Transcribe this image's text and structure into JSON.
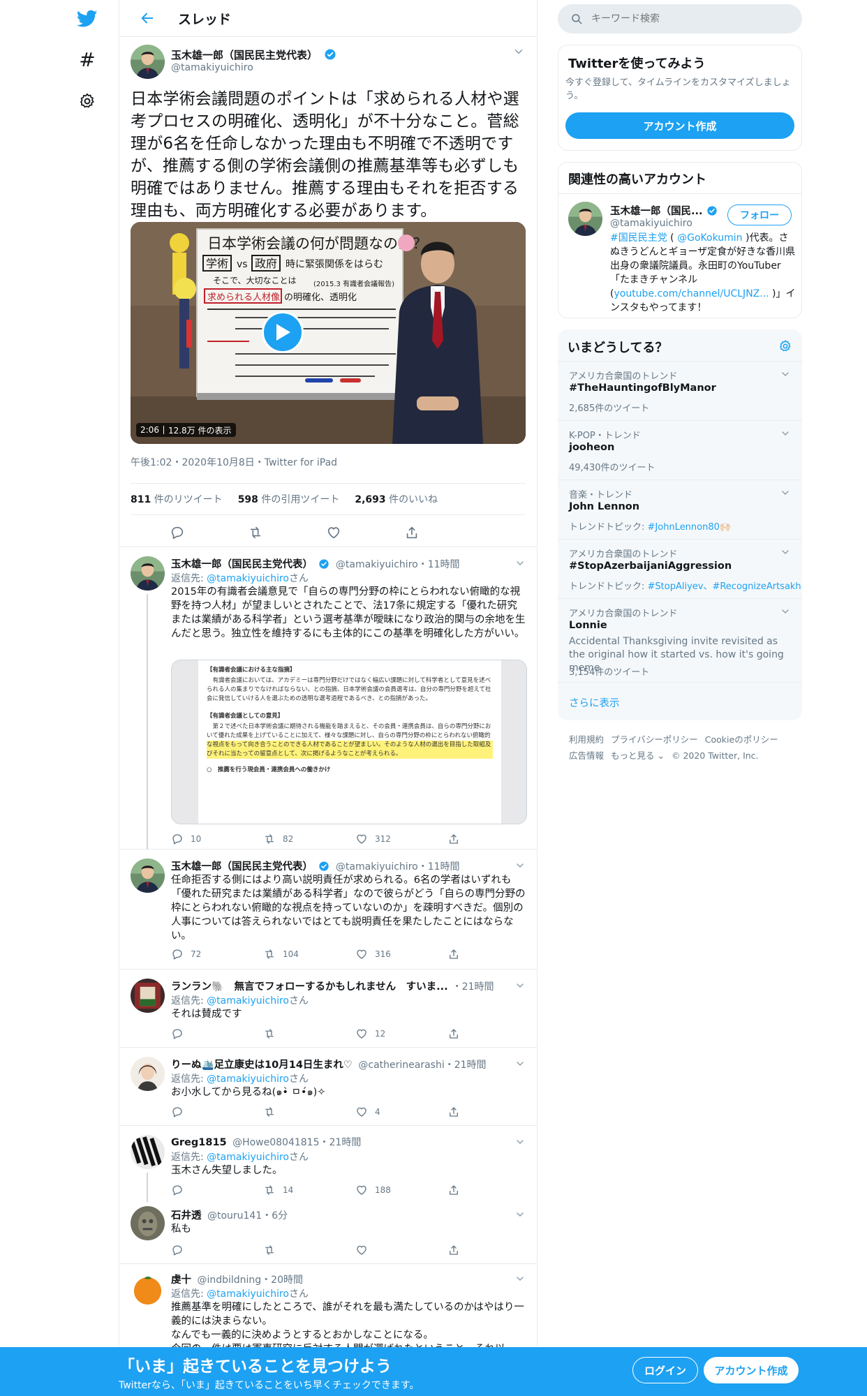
{
  "nav": {
    "logo": "twitter-bird",
    "explore": "#",
    "settings": "gear"
  },
  "header": {
    "title": "スレッド"
  },
  "main_tweet": {
    "name": "玉木雄一郎（国民民主党代表）",
    "handle": "@tamakiyuichiro",
    "text": "日本学術会議問題のポイントは「求められる人材や選考プロセスの明確化、透明化」が不十分なこと。菅総理が6名を任命しなかった理由も不明確で不透明ですが、推薦する側の学術会議側の推薦基準等も必ずしも明確ではありません。推薦する理由もそれを拒否する理由も、両方明確化する必要があります。",
    "video": {
      "duration": "2:06",
      "views": "12.8万 件の表示",
      "board_title": "日本学術会議の何が問題なのか？",
      "board_line1": "学術",
      "board_vs": "vs",
      "board_line1b": "政府",
      "board_line1c": "時に緊張関係をはらむ",
      "board_line2": "そこで、大切なことは",
      "board_line2b": "(2015.3 有識者会議報告)",
      "board_line3": "求められる人材像",
      "board_line3b": "の明確化、透明化"
    },
    "meta": "午後1:02・2020年10月8日・Twitter for iPad",
    "stats": {
      "retweets_num": "811",
      "retweets_label": "件のリツイート",
      "quotes_num": "598",
      "quotes_label": "件の引用ツイート",
      "likes_num": "2,693",
      "likes_label": "件のいいね"
    }
  },
  "replies": [
    {
      "name": "玉木雄一郎（国民民主党代表）",
      "handle": "@tamakiyuichiro",
      "time": "・11時間",
      "replying_label": "返信先:",
      "replying_to": "@tamakiyuichiro",
      "replying_suffix": "さん",
      "text": "2015年の有識者会議意見で「自らの専門分野の枠にとらわれない俯瞰的な視野を持つ人材」が望ましいとされたことで、法17条に規定する「優れた研究または業績がある科学者」という選考基準が曖昧になり政治的関与の余地を生んだと思う。独立性を維持するにも主体的にこの基準を明確化した方がいい。",
      "doc": {
        "h1": "【有識者会議における主な指摘】",
        "p1": "有識者会議においては、アカデミーは専門分野だけではなく幅広い課題に対して科学者として意見を述べられる人の集まりでなければならない、との指摘、日本学術会議の会員選考は、自分の専門分野を超えて社会に発信していける人を選ぶための透明な選考過程であるべき、との指摘があった。",
        "h2": "【有識者会議としての意見】",
        "p2": "第２で述べた日本学術会議に期待される機能を踏まえると、その会員・連携会員は、自らの専門分野において優れた成果を上げていることに加えて、様々な課題に対し、自らの専門分野の枠にとらわれない俯瞰的な視点をもって向き合うことのできる人材であることが望ましい。そのような人材の選出を目指した取組及びそれに当たっての留意点として、次に掲げるようなことが考えられる。",
        "bullet": "○　推薦を行う現会員・連携会員への働きかけ"
      },
      "replies": "10",
      "retweets": "82",
      "likes": "312"
    },
    {
      "name": "玉木雄一郎（国民民主党代表）",
      "handle": "@tamakiyuichiro",
      "time": "・11時間",
      "text": "任命拒否する側にはより高い説明責任が求められる。6名の学者はいずれも「優れた研究または業績がある科学者」なので彼らがどう「自らの専門分野の枠にとらわれない俯瞰的な視点を持っていないのか」を疎明すべきだ。個別の人事については答えられないではとても説明責任を果たしたことにはならない。",
      "replies": "72",
      "retweets": "104",
      "likes": "316"
    },
    {
      "name": "ランラン🐘　無言でフォローするかもしれません　すいま...",
      "time": "・21時間",
      "replying_label": "返信先:",
      "replying_to": "@tamakiyuichiro",
      "replying_suffix": "さん",
      "text": "それは賛成です",
      "likes": "12"
    },
    {
      "name": "りーぬ🛳️足立康史は10月14日生まれ♡",
      "handle": "@catherinearashi",
      "time": "・21時間",
      "replying_label": "返信先:",
      "replying_to": "@tamakiyuichiro",
      "replying_suffix": "さん",
      "text": "お小水してから見るね(๑•̀ ㅁ•́๑)✧",
      "likes": "4"
    },
    {
      "name": "Greg1815",
      "handle": "@Howe08041815",
      "time": "・21時間",
      "replying_label": "返信先:",
      "replying_to": "@tamakiyuichiro",
      "replying_suffix": "さん",
      "text": "玉木さん失望しました。",
      "retweets": "14",
      "likes": "188"
    },
    {
      "name": "石井透",
      "handle": "@touru141",
      "time": "・6分",
      "text": "私も"
    },
    {
      "name": "虔十",
      "handle": "@indbildning",
      "time": "・20時間",
      "replying_label": "返信先:",
      "replying_to": "@tamakiyuichiro",
      "replying_suffix": "さん",
      "text1": "推薦基準を明確にしたところで、誰がそれを最も満たしているのかはやはり一義的には決まらない。",
      "text2": "なんでも一義的に決めようとするとおかしなことになる。",
      "text3": "今回の一件は要は軍事研究に反対する人間が選ばれたということ。それ以"
    }
  ],
  "sidebar": {
    "search_placeholder": "キーワード検索",
    "signup_card": {
      "title": "Twitterを使ってみよう",
      "desc": "今すぐ登録して、タイムラインをカスタマイズしましょう。",
      "button": "アカウント作成"
    },
    "related": {
      "title": "関連性の高いアカウント",
      "name": "玉木雄一郎（国民...",
      "handle": "@tamakiyuichiro",
      "follow": "フォロー",
      "bio_tag": "#国民民主党",
      "bio_a": " ( ",
      "bio_mention": "@GoKokumin",
      "bio_b": " )代表。さぬきうどんとギョーザ定食が好きな香川県出身の衆議院議員。永田町のYouTuber「たまきチャンネル(",
      "bio_link": "youtube.com/channel/UCLJNZ...",
      "bio_c": " )」インスタもやってます！"
    },
    "trends": {
      "title": "いまどうしてる？",
      "items": [
        {
          "context": "アメリカ合衆国のトレンド",
          "title": "#TheHauntingofBlyManor",
          "sub": "2,685件のツイート"
        },
        {
          "context": "K-POP・トレンド",
          "title": "jooheon",
          "sub": "49,430件のツイート"
        },
        {
          "context": "音楽・トレンド",
          "title": "John Lennon",
          "sub_label": "トレンドトピック: ",
          "sub_link": "#JohnLennon80",
          "sub_emoji": "🙌🏻"
        },
        {
          "context": "アメリカ合衆国のトレンド",
          "title": "#StopAzerbaijaniAggression",
          "sub_label": "トレンドトピック: ",
          "sub_link": "#StopAliyev、#RecognizeArtsakh"
        },
        {
          "context": "アメリカ合衆国のトレンド",
          "title": "Lonnie",
          "desc": "Accidental Thanksgiving invite revisited as the original how it started vs. how it's going meme",
          "sub": "3,154件のツイート"
        }
      ],
      "more": "さらに表示"
    },
    "footer": {
      "terms": "利用規約",
      "privacy": "プライバシーポリシー",
      "cookie": "Cookieのポリシー",
      "ads": "広告情報",
      "more": "もっと見る ⌄",
      "copyright": "© 2020 Twitter, Inc."
    }
  },
  "bottom_bar": {
    "title": "「いま」起きていることを見つけよう",
    "subtitle": "Twitterなら、「いま」起きていることをいち早くチェックできます。",
    "login": "ログイン",
    "signup": "アカウント作成"
  },
  "colors": {
    "accent": "#1da1f2",
    "text": "#14171a",
    "muted": "#657786",
    "border": "#e6ecf0"
  }
}
